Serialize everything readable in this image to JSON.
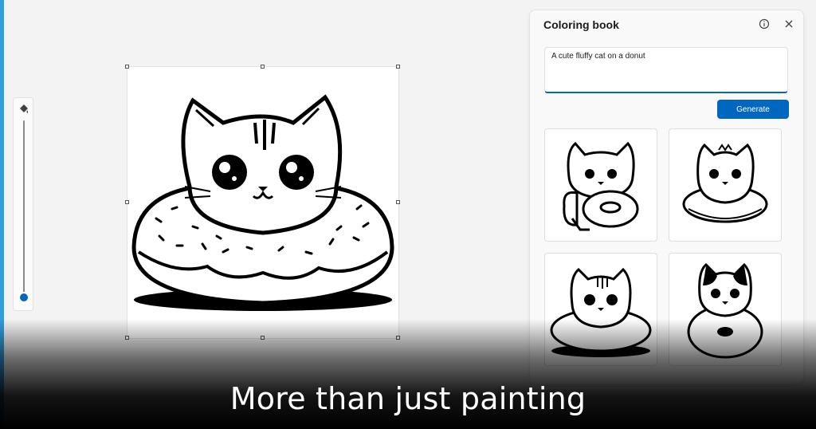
{
  "panel": {
    "title": "Coloring book",
    "prompt_value": "A cute fluffy cat on a donut",
    "generate_label": "Generate",
    "thumbnails": [
      {
        "icon": "cat-hugging-donut-thumbnail"
      },
      {
        "icon": "fluffy-cat-on-donut-thumbnail"
      },
      {
        "icon": "striped-cat-in-donut-thumbnail"
      },
      {
        "icon": "spotted-cat-on-donut-thumbnail"
      }
    ]
  },
  "canvas": {
    "image": "cat-on-donut-coloring-page"
  },
  "zoom_slider": {
    "icon": "paint-bucket-icon",
    "level": 0.0
  },
  "caption": "More than just painting",
  "colors": {
    "accent": "#0067c0",
    "background": "#f3f3f3",
    "panel": "#f9f9f9"
  }
}
